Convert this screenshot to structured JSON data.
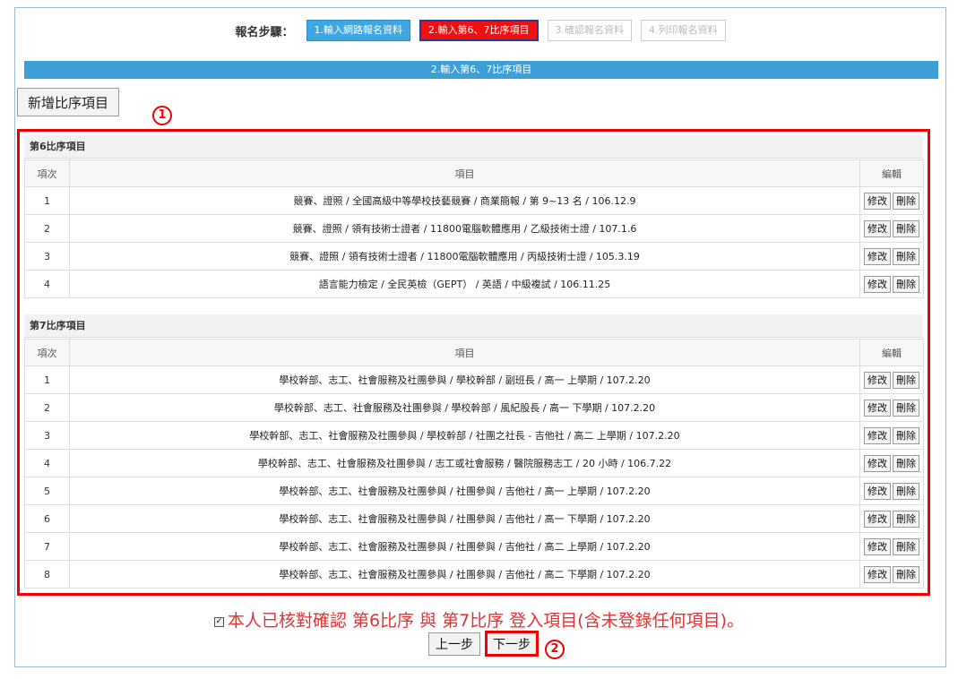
{
  "steps": {
    "label": "報名步驟：",
    "items": [
      {
        "label": "1.輸入網路報名資料"
      },
      {
        "label": "2.輸入第6、7比序項目"
      },
      {
        "label": "3.確認報名資料"
      },
      {
        "label": "4.列印報名資料"
      }
    ]
  },
  "page_title": "2.輸入第6、7比序項目",
  "add_button": "新增比序項目",
  "annotations": {
    "one": "1",
    "two": "2"
  },
  "columns": {
    "index": "項次",
    "item": "項目",
    "edit": "編輯"
  },
  "actions": {
    "modify": "修改",
    "delete": "刪除"
  },
  "section6": {
    "title": "第6比序項目",
    "rows": [
      {
        "no": "1",
        "item": "競賽、證照 / 全國高級中等學校技藝競賽 / 商業簡報 / 第 9~13 名 / 106.12.9"
      },
      {
        "no": "2",
        "item": "競賽、證照 / 領有技術士證者 / 11800電腦軟體應用 / 乙級技術士證 / 107.1.6"
      },
      {
        "no": "3",
        "item": "競賽、證照 / 領有技術士證者 / 11800電腦軟體應用 / 丙級技術士證 / 105.3.19"
      },
      {
        "no": "4",
        "item": "語言能力檢定 / 全民英檢（GEPT） / 英語 / 中級複試 / 106.11.25"
      }
    ]
  },
  "section7": {
    "title": "第7比序項目",
    "rows": [
      {
        "no": "1",
        "item": "學校幹部、志工、社會服務及社團參與 / 學校幹部 / 副班長 / 高一 上學期 / 107.2.20"
      },
      {
        "no": "2",
        "item": "學校幹部、志工、社會服務及社團參與 / 學校幹部 / 風紀股長 / 高一 下學期 / 107.2.20"
      },
      {
        "no": "3",
        "item": "學校幹部、志工、社會服務及社團參與 / 學校幹部 / 社團之社長 - 吉他社 / 高二 上學期 / 107.2.20"
      },
      {
        "no": "4",
        "item": "學校幹部、志工、社會服務及社團參與 / 志工或社會服務 / 醫院服務志工 / 20 小時 / 106.7.22"
      },
      {
        "no": "5",
        "item": "學校幹部、志工、社會服務及社團參與 / 社團參與 / 吉他社 / 高一 上學期 / 107.2.20"
      },
      {
        "no": "6",
        "item": "學校幹部、志工、社會服務及社團參與 / 社團參與 / 吉他社 / 高一 下學期 / 107.2.20"
      },
      {
        "no": "7",
        "item": "學校幹部、志工、社會服務及社團參與 / 社團參與 / 吉他社 / 高二 上學期 / 107.2.20"
      },
      {
        "no": "8",
        "item": "學校幹部、志工、社會服務及社團參與 / 社團參與 / 吉他社 / 高二 下學期 / 107.2.20"
      }
    ]
  },
  "confirm_text": "本人已核對確認 第6比序 與 第7比序 登入項目(含未登錄任何項目)。",
  "checkbox_mark": "✓",
  "nav": {
    "prev": "上一步",
    "next": "下一步"
  }
}
